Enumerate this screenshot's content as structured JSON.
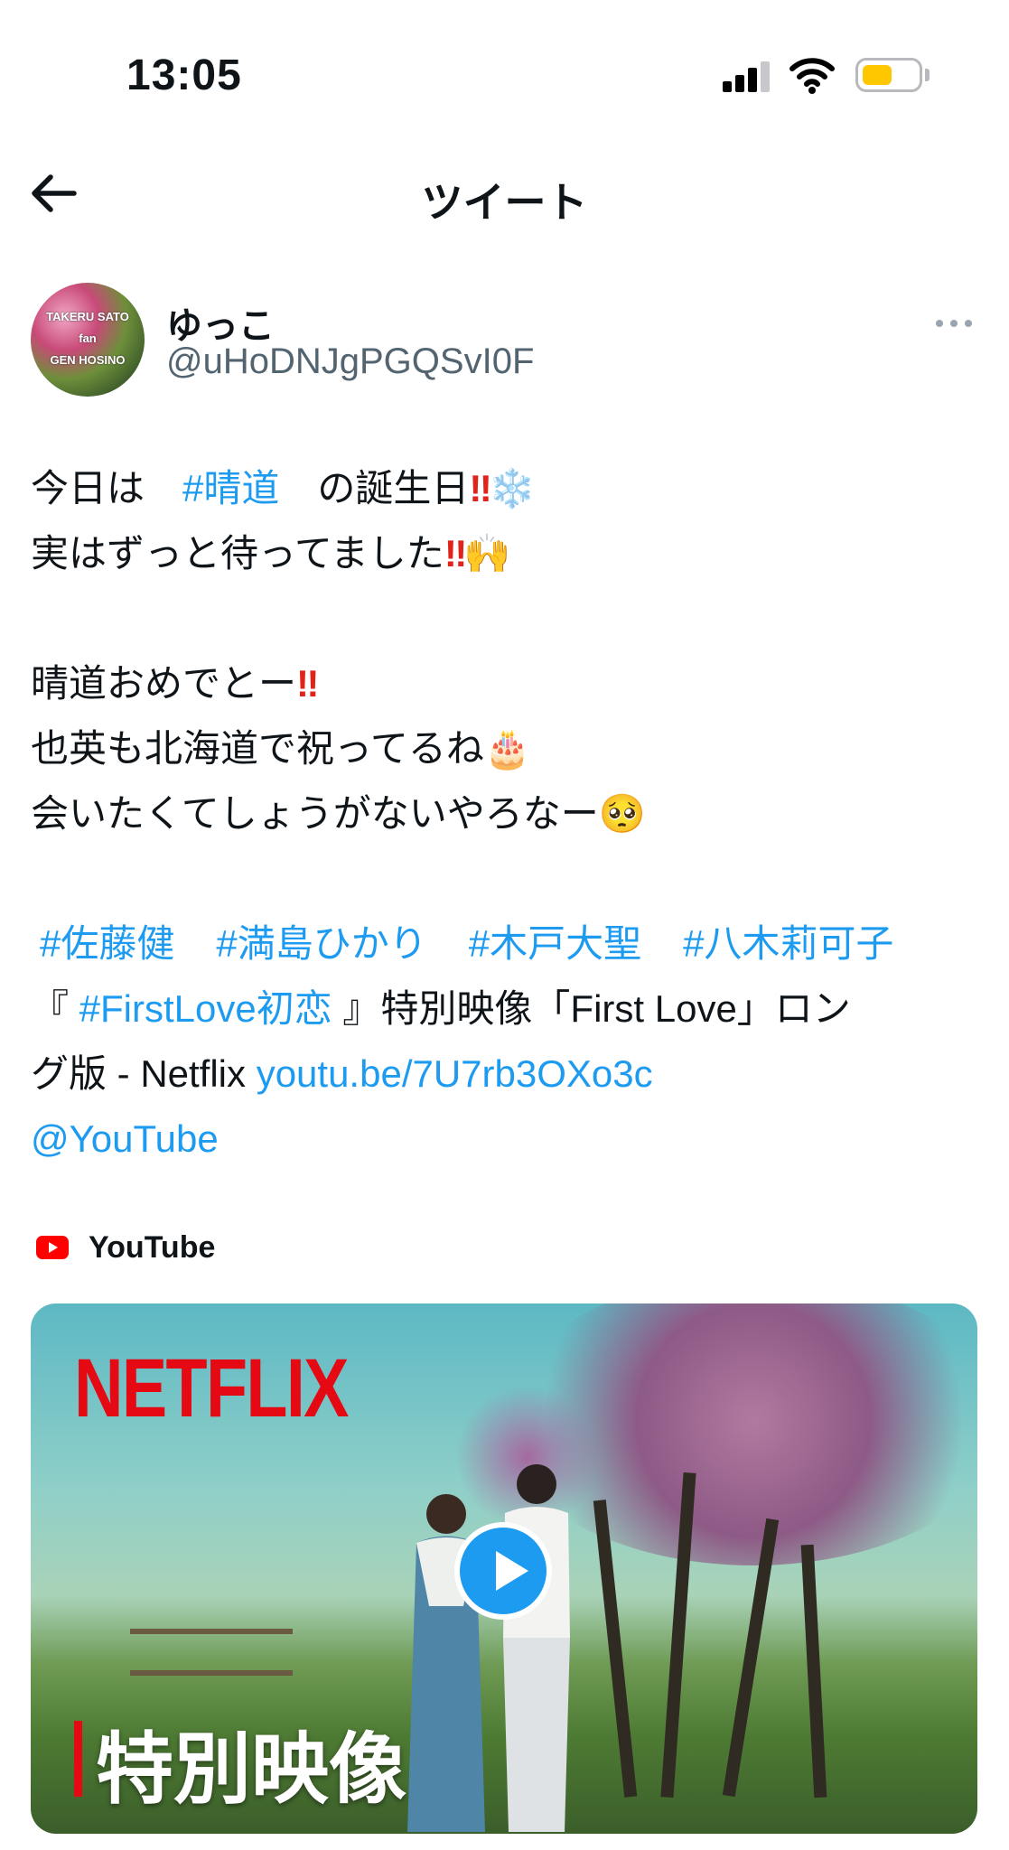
{
  "status_bar": {
    "time": "13:05",
    "battery_color": "#ffc700",
    "battery_level": 0.55
  },
  "header": {
    "title": "ツイート"
  },
  "author": {
    "display_name": "ゆっこ",
    "handle": "@uHoDNJgPGQSvI0F",
    "avatar_text": [
      "TAKERU SATO",
      "fan",
      "GEN HOSINO"
    ]
  },
  "tweet": {
    "l1_a": "今日は　",
    "l1_tag": "#晴道",
    "l1_b": "　の誕生日",
    "l1_bang": "‼",
    "l1_emoji": "❄️",
    "l2_a": "実はずっと待ってました",
    "l2_bang": "‼",
    "l2_emoji": "🙌",
    "l3_a": "晴道おめでとー",
    "l3_bang": "‼",
    "l4_a": "也英も北海道で祝ってるね",
    "l4_emoji": "🎂",
    "l5_a": "会いたくてしょうがないやろなー",
    "l5_emoji": "🥺",
    "tags": [
      "#佐藤健",
      "#満島ひかり",
      "#木戸大聖",
      "#八木莉可子"
    ],
    "l7_a": "『 ",
    "l7_tag": "#FirstLove初恋",
    "l7_b": " 』特別映像「First Love」ロン",
    "l8_a": "グ版 - Netflix ",
    "l8_link": "youtu.be/7U7rb3OXo3c",
    "l9_mention": "@YouTube"
  },
  "card": {
    "source": "YouTube",
    "logo": "NETFLIX",
    "caption": "特別映像",
    "accent": "#e50914",
    "play_color": "#1d9bf0"
  },
  "colors": {
    "link": "#1d9bf0",
    "secondary_text": "#536471"
  },
  "icons": [
    "back-arrow-icon",
    "more-icon",
    "signal-icon",
    "wifi-icon",
    "battery-icon",
    "youtube-logo-icon",
    "play-icon"
  ]
}
